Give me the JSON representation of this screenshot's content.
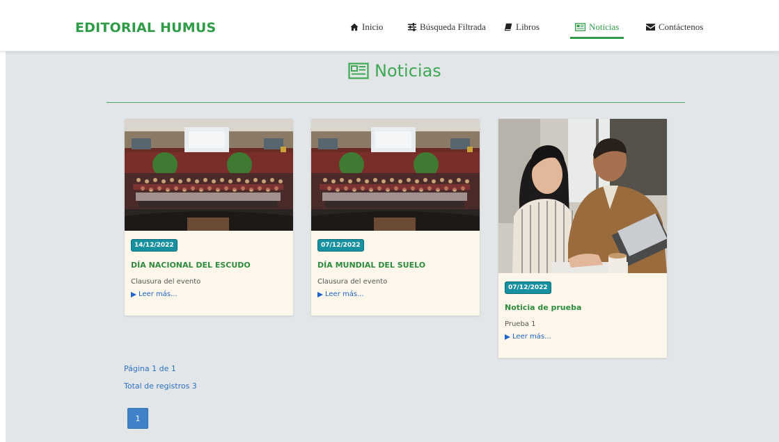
{
  "brand": "EDITORIAL HUMUS",
  "nav": {
    "items": [
      {
        "label": "Inicio",
        "icon": "home-icon"
      },
      {
        "label": "Búsqueda Filtrada",
        "icon": "sliders-icon"
      },
      {
        "label": "Libros",
        "icon": "book-icon"
      },
      {
        "label": "Noticias",
        "icon": "newspaper-icon",
        "active": true
      },
      {
        "label": "Contáctenos",
        "icon": "envelope-icon"
      }
    ]
  },
  "page": {
    "title": "Noticias",
    "title_icon": "newspaper-icon"
  },
  "news": [
    {
      "date": "14/12/2022",
      "title": "DÍA NACIONAL DEL ESCUDO",
      "description": "Clausura del evento",
      "link": "Leer más..."
    },
    {
      "date": "07/12/2022",
      "title": "DÍA MUNDIAL DEL SUELO",
      "description": "Clausura del evento",
      "link": "Leer más..."
    },
    {
      "date": "07/12/2022",
      "title": "Noticia de prueba",
      "description": "Prueba 1",
      "link": "Leer más..."
    }
  ],
  "pagination": {
    "page_info": "Página 1 de 1",
    "total_info": "Total de registros 3",
    "current_page": "1"
  },
  "colors": {
    "brand_green": "#2e9c46",
    "badge_teal": "#17919f",
    "link_blue": "#1e63c8",
    "card_bg": "#fcf7ea",
    "page_bg": "#e3e6e8"
  }
}
